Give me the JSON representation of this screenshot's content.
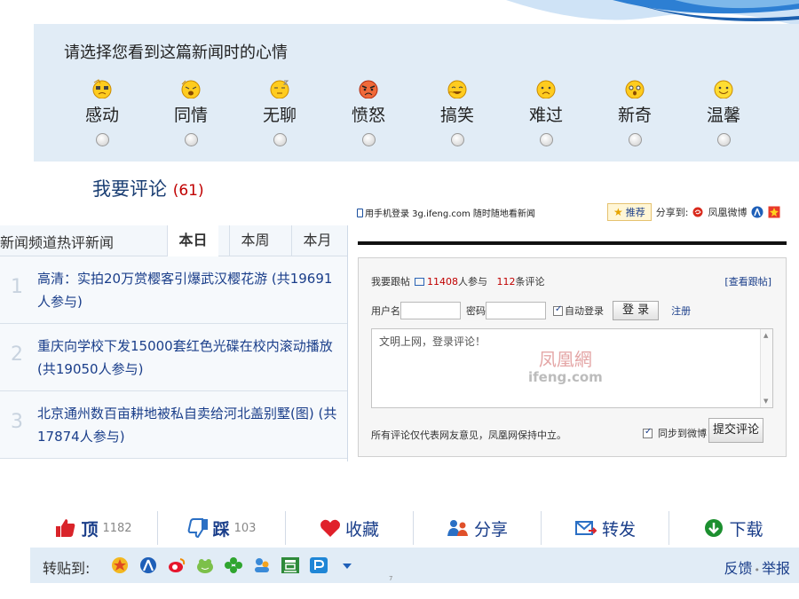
{
  "mood": {
    "title": "请选择您看到这篇新闻时的心情",
    "items": [
      {
        "label": "感动",
        "icon": "moved-face-icon"
      },
      {
        "label": "同情",
        "icon": "sympathy-face-icon"
      },
      {
        "label": "无聊",
        "icon": "bored-face-icon"
      },
      {
        "label": "愤怒",
        "icon": "angry-face-icon"
      },
      {
        "label": "搞笑",
        "icon": "laughing-face-icon"
      },
      {
        "label": "难过",
        "icon": "sad-face-icon"
      },
      {
        "label": "新奇",
        "icon": "surprised-face-icon"
      },
      {
        "label": "温馨",
        "icon": "warm-smile-icon"
      }
    ]
  },
  "comment": {
    "heading": "我要评论",
    "count": "(61)"
  },
  "hot": {
    "title": "新闻频道热评新闻",
    "tabs": [
      {
        "label": "本日"
      },
      {
        "label": "本周"
      },
      {
        "label": "本月"
      }
    ],
    "active_tab": "本日",
    "items": [
      {
        "num": "1",
        "text": "高清：实拍20万赏樱客引爆武汉樱花游 (共19691人参与)"
      },
      {
        "num": "2",
        "text": "重庆向学校下发15000套红色光碟在校内滚动播放 (共19050人参与)"
      },
      {
        "num": "3",
        "text": "北京通州数百亩耕地被私自卖给河北盖别墅(图) (共17874人参与)"
      }
    ]
  },
  "mobile_line": "用手机登录 3g.ifeng.com 随时随地看新闻",
  "share": {
    "recommend": "推荐",
    "share_to": "分享到:",
    "weibo": "凤凰微博"
  },
  "post": {
    "title": "我要跟帖",
    "participants": "11408",
    "participants_suffix": "人参与",
    "comments": "112",
    "comments_suffix": "条评论",
    "view_link": "[查看跟帖]",
    "username_label": "用户名",
    "password_label": "密码",
    "auto_login": "自动登录",
    "login_button": "登 录",
    "register": "注册",
    "placeholder": "文明上网，登录评论！",
    "watermark": "凤凰網",
    "watermark_sub": "ifeng.com",
    "disclaimer": "所有评论仅代表网友意见，凤凰网保持中立。",
    "sync_weibo": "同步到微博",
    "submit": "提交评论"
  },
  "actions": [
    {
      "label": "顶",
      "count": "1182",
      "icon": "thumbs-up-icon",
      "color": "#d9242a"
    },
    {
      "label": "踩",
      "count": "103",
      "icon": "thumbs-down-icon",
      "color": "#2a6fc4"
    },
    {
      "label": "收藏",
      "count": "",
      "icon": "heart-icon",
      "color": "#e0202a"
    },
    {
      "label": "分享",
      "count": "",
      "icon": "share-people-icon",
      "color": "#2a6fc4"
    },
    {
      "label": "转发",
      "count": "",
      "icon": "forward-mail-icon",
      "color": "#2a6fc4"
    },
    {
      "label": "下载",
      "count": "",
      "icon": "download-icon",
      "color": "#1c8f2f"
    }
  ],
  "repost": {
    "label": "转贴到:",
    "icons": [
      "qzone-icon",
      "baidu-icon",
      "sina-weibo-icon",
      "kaixin-icon",
      "clover-icon",
      "renren-icon",
      "douban-icon",
      "pengyou-icon",
      "more-arrow-icon"
    ],
    "feedback": "反馈",
    "report": "举报"
  },
  "tiny_mark": "7"
}
